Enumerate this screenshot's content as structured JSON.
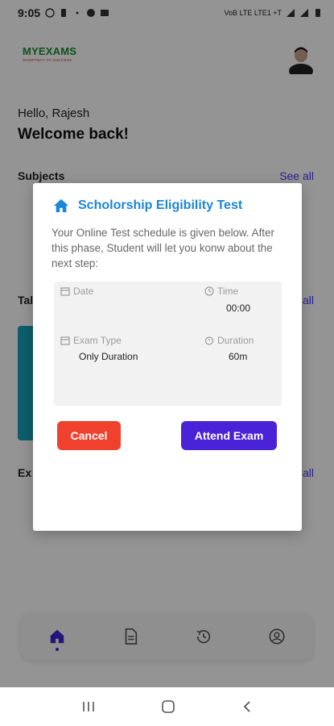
{
  "status_bar": {
    "time": "9:05",
    "network_label": "VoB LTE LTE1 +T"
  },
  "header": {
    "logo_text": "MYEXAMS",
    "logo_tagline": "SHORTWAY TO SUCCESS"
  },
  "home": {
    "greeting": "Hello, Rajesh",
    "welcome": "Welcome back!",
    "subjects_title": "Subjects",
    "see_all": "See all",
    "section2_title": "Tal",
    "section3_title": "Ex",
    "see_all_partial": "all"
  },
  "modal": {
    "title": "Scholorship Eligibility Test",
    "description": "Your Online Test schedule is given below. After this phase, Student will let you konw about the next step:",
    "date_label": "Date",
    "date_value": "",
    "time_label": "Time",
    "time_value": "00:00",
    "exam_type_label": "Exam Type",
    "exam_type_value": "Only Duration",
    "duration_label": "Duration",
    "duration_value": "60m",
    "cancel_label": "Cancel",
    "attend_label": "Attend Exam"
  },
  "bottom_nav": {
    "items": [
      "home-icon",
      "document-icon",
      "history-icon",
      "profile-icon"
    ],
    "active": "home-icon"
  },
  "colors": {
    "accent": "#4a22d8",
    "title_blue": "#1a86d6",
    "cancel_red": "#f0412f",
    "teal": "#17a2b8"
  }
}
